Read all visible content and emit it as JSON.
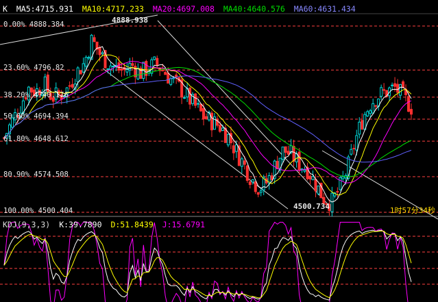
{
  "header": {
    "symbol": "K",
    "ma5": "MA5:4715.931",
    "ma10": "MA10:4717.233",
    "ma20": "MA20:4697.008",
    "ma40": "MA40:4640.576",
    "ma60": "MA60:4631.434"
  },
  "colors": {
    "ma5": "#ffffff",
    "ma10": "#ffff00",
    "ma20": "#ff00ff",
    "ma40": "#00e000",
    "ma60": "#6060ff",
    "up": "#00d8d8",
    "down": "#ff3030",
    "fibo_line": "#ff4040",
    "channel": "#dddddd"
  },
  "fibonacci": [
    {
      "label": "0.00% 4888.384",
      "price": 4888.384
    },
    {
      "label": "23.60% 4796.82",
      "price": 4796.82
    },
    {
      "label": "38.20% 4740.176",
      "price": 4740.176
    },
    {
      "label": "50.00% 4694.394",
      "price": 4694.394
    },
    {
      "label": "61.80% 4648.612",
      "price": 4648.612
    },
    {
      "label": "80.90% 4574.508",
      "price": 4574.508
    },
    {
      "label": "100.00% 4500.404",
      "price": 4500.404
    }
  ],
  "markers": {
    "high": "4888.938",
    "low": "4500.734"
  },
  "countdown": "1时57分34秒",
  "kdj": {
    "title": "KDJ(9,3,3)",
    "k": "K:39.7890",
    "d": "D:51.8439",
    "j": "J:15.6791"
  },
  "chart_data": {
    "type": "candlestick",
    "ylim": [
      4500.404,
      4888.384
    ],
    "close_path": [
      4655,
      4690,
      4720,
      4760,
      4752,
      4768,
      4740,
      4745,
      4758,
      4790,
      4810,
      4860,
      4830,
      4812,
      4800,
      4795,
      4808,
      4790,
      4800,
      4810,
      4795,
      4775,
      4760,
      4740,
      4720,
      4700,
      4690,
      4680,
      4660,
      4630,
      4600,
      4570,
      4550,
      4565,
      4600,
      4630,
      4620,
      4600,
      4590,
      4560,
      4530,
      4520,
      4550,
      4590,
      4650,
      4700,
      4730,
      4745,
      4752,
      4760,
      4740,
      4720
    ]
  }
}
